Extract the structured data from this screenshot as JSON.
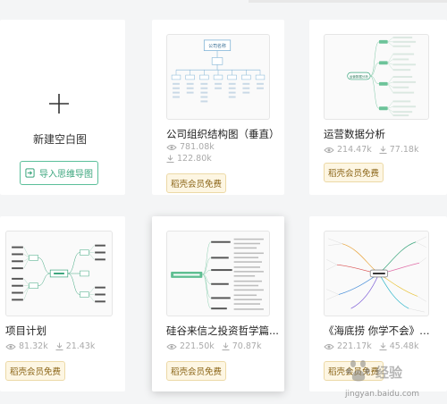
{
  "new_card": {
    "label": "新建空白图",
    "import_label": "导入思维导图"
  },
  "templates": [
    {
      "title": "公司组织结构图（垂直）",
      "views": "781.08k",
      "downloads": "122.80k",
      "badge": "稻壳会员免费"
    },
    {
      "title": "运营数据分析",
      "views": "214.47k",
      "downloads": "77.18k",
      "badge": "稻壳会员免费"
    },
    {
      "title": "项目计划",
      "views": "81.32k",
      "downloads": "21.43k",
      "badge": "稻壳会员免费"
    },
    {
      "title": "硅谷来信之投资哲学篇...",
      "views": "221.50k",
      "downloads": "70.87k",
      "badge": "稻壳会员免费"
    },
    {
      "title": "《海底捞 你学不会》读...",
      "views": "221.17k",
      "downloads": "45.48k",
      "badge": "稻壳会员免费"
    }
  ],
  "thumb_labels": {
    "org_root": "公司名称",
    "ops_center": "运营数据分析"
  },
  "watermark": {
    "brand": "经验",
    "url": "jingyan.baidu.com"
  },
  "colors": {
    "accent_green": "#3aa57c",
    "badge_bg": "#fdf6e3",
    "badge_text": "#8a6416"
  }
}
